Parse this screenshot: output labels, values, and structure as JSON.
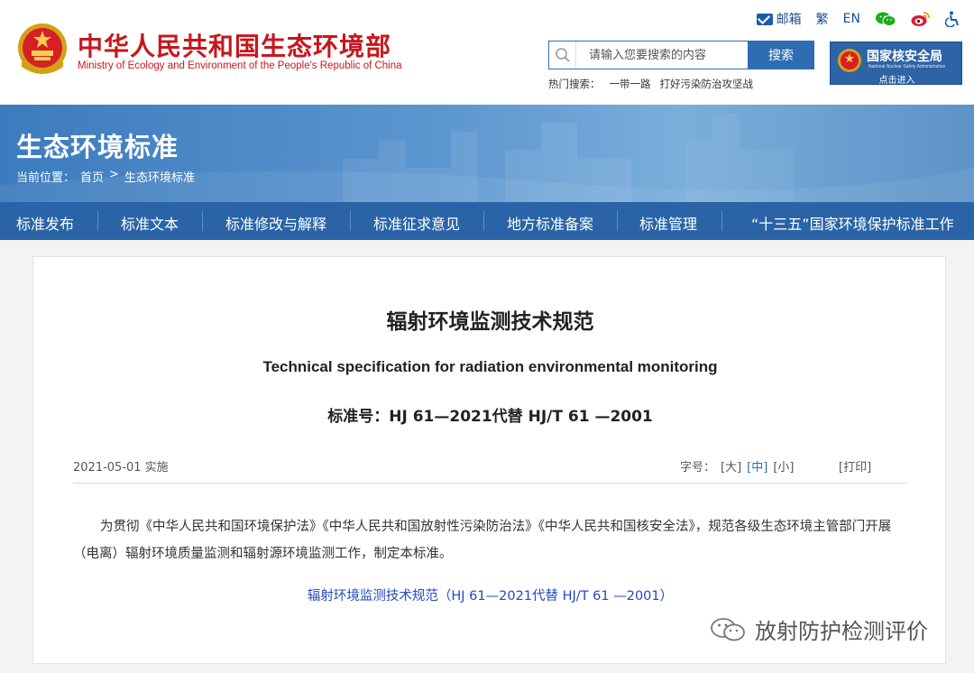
{
  "header": {
    "title": "中华人民共和国生态环境部",
    "subtitle": "Ministry of Ecology and Environment of the People's Republic of China",
    "toplinks": {
      "mail": "邮箱",
      "traditional": "繁",
      "english": "EN"
    },
    "search": {
      "placeholder": "请输入您要搜索的内容",
      "button": "搜索"
    },
    "hot": {
      "label": "热门搜索：",
      "items": [
        "一带一路",
        "打好污染防治攻坚战"
      ]
    },
    "nnsa": {
      "title": "国家核安全局",
      "en": "National Nuclear Safety Administration",
      "enter": "点击进入"
    }
  },
  "banner": {
    "title": "生态环境标准",
    "breadcrumb": {
      "label": "当前位置：",
      "home": "首页",
      "sep": ">",
      "current": "生态环境标准"
    }
  },
  "nav": [
    "标准发布",
    "标准文本",
    "标准修改与解释",
    "标准征求意见",
    "地方标准备案",
    "标准管理",
    "“十三五”国家环境保护标准工作"
  ],
  "article": {
    "title": "辐射环境监测技术规范",
    "title_en": "Technical specification for radiation environmental monitoring",
    "standard_no": "标准号：HJ 61—2021代替 HJ/T 61 —2001",
    "date": "2021-05-01 实施",
    "fontsize": {
      "label": "字号：",
      "large": "[大]",
      "medium": "[中]",
      "small": "[小]"
    },
    "print": "[打印]",
    "paragraph": "为贯彻《中华人民共和国环境保护法》《中华人民共和国放射性污染防治法》《中华人民共和国核安全法》，规范各级生态环境主管部门开展（电离）辐射环境质量监测和辐射源环境监测工作，制定本标准。",
    "link": "辐射环境监测技术规范（HJ 61—2021代替 HJ/T 61 —2001）"
  },
  "watermark": {
    "text": "放射防护检测评价"
  },
  "colors": {
    "brand_red": "#c8161d",
    "nav_blue": "#2a64a6",
    "link_blue": "#2148c5"
  }
}
